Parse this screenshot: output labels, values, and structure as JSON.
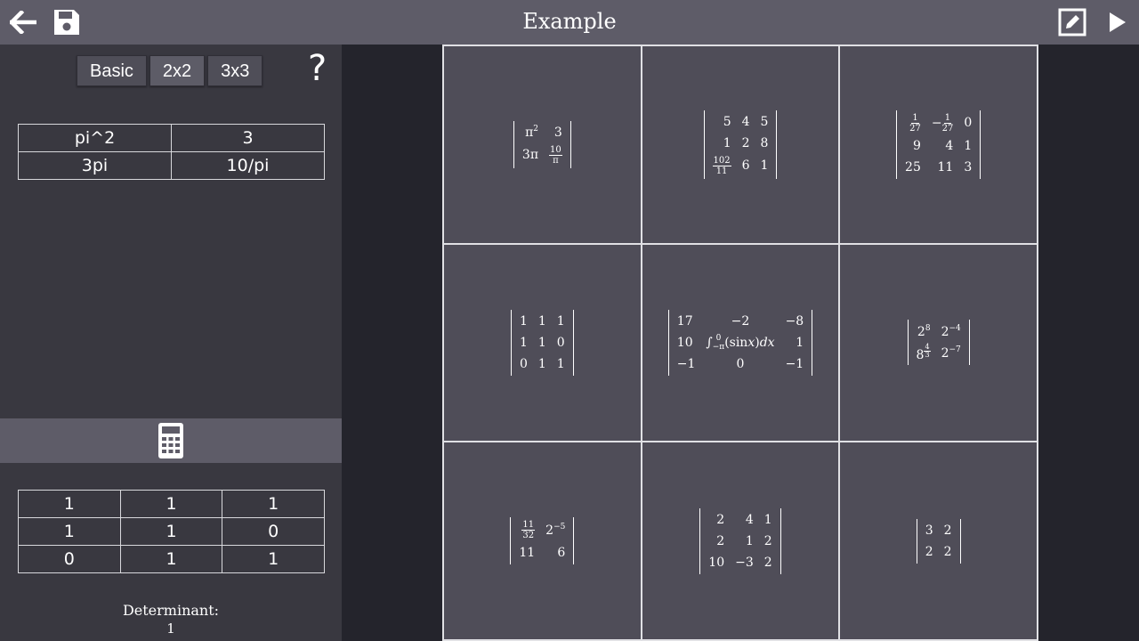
{
  "header": {
    "title": "Example"
  },
  "icons": {
    "back": "arrow-left-icon",
    "save": "save-icon",
    "edit": "edit-icon",
    "play": "play-icon",
    "help": "help-icon",
    "calc": "calculator-icon"
  },
  "mode_tabs": [
    "Basic",
    "2x2",
    "3x3"
  ],
  "help_label": "?",
  "input_matrix": [
    [
      "pi^2",
      "3"
    ],
    [
      "3pi",
      "10/pi"
    ]
  ],
  "result_matrix": [
    [
      "1",
      "1",
      "1"
    ],
    [
      "1",
      "1",
      "0"
    ],
    [
      "0",
      "1",
      "1"
    ]
  ],
  "determinant": {
    "label": "Determinant:",
    "value": "1"
  },
  "gallery": {
    "m1": {
      "r1": [
        "π2",
        "3"
      ],
      "r2": [
        "3π",
        "10/π"
      ]
    },
    "m2": {
      "r1": [
        "5",
        "4",
        "5"
      ],
      "r2": [
        "1",
        "2",
        "8"
      ],
      "r3": [
        "102/11",
        "6",
        "1"
      ]
    },
    "m3": {
      "r1": [
        "1/27",
        "−1/27",
        "0"
      ],
      "r2": [
        "9",
        "4",
        "1"
      ],
      "r3": [
        "25",
        "11",
        "3"
      ]
    },
    "m4": {
      "r1": [
        "1",
        "1",
        "1"
      ],
      "r2": [
        "1",
        "1",
        "0"
      ],
      "r3": [
        "0",
        "1",
        "1"
      ]
    },
    "m5": {
      "r1": [
        "17",
        "−2",
        "−8"
      ],
      "r2": [
        "10",
        "∫−π0 (sin x)dx",
        "1"
      ],
      "r3": [
        "−1",
        "0",
        "−1"
      ]
    },
    "m6": {
      "r1": [
        "28",
        "2−4"
      ],
      "r2": [
        "84/3",
        "2−7"
      ]
    },
    "m7": {
      "r1": [
        "11/32",
        "2−5"
      ],
      "r2": [
        "11",
        "6"
      ]
    },
    "m8": {
      "r1": [
        "2",
        "4",
        "1"
      ],
      "r2": [
        "2",
        "1",
        "2"
      ],
      "r3": [
        "10",
        "−3",
        "2"
      ]
    },
    "m9": {
      "r1": [
        "3",
        "2"
      ],
      "r2": [
        "2",
        "2"
      ]
    }
  }
}
